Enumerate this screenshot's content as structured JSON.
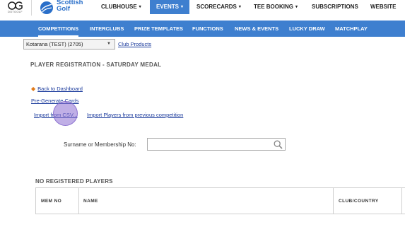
{
  "header": {
    "og_logo_text": "DOTGOLF",
    "brand": {
      "line1": "Scottish",
      "line2": "Golf"
    },
    "nav": [
      {
        "label": "CLUBHOUSE",
        "caret": "▾"
      },
      {
        "label": "EVENTS",
        "caret": "▾",
        "active": true
      },
      {
        "label": "SCORECARDS",
        "caret": "▾"
      },
      {
        "label": "TEE BOOKING",
        "caret": "▾"
      },
      {
        "label": "SUBSCRIPTIONS",
        "caret": ""
      },
      {
        "label": "WEBSITE",
        "caret": ""
      }
    ]
  },
  "subnav": {
    "items": [
      "COMPETITIONS",
      "INTERCLUBS",
      "PRIZE TEMPLATES",
      "FUNCTIONS",
      "NEWS & EVENTS",
      "LUCKY DRAW",
      "MATCHPLAY"
    ]
  },
  "club": {
    "selected": "Kotarana (TEST) (2705)",
    "products_link": "Club Products"
  },
  "page": {
    "title": "PLAYER REGISTRATION - SATURDAY MEDAL",
    "back_link": "Back to Dashboard",
    "pregen_link": "Pre-Generate Cards",
    "import_csv_link": "Import from CSV...",
    "import_prev_link": "Import Players from previous competition"
  },
  "search": {
    "label": "Surname or Membership No:",
    "value": "",
    "placeholder": ""
  },
  "players": {
    "heading": "NO REGISTERED PLAYERS",
    "columns": [
      "MEM NO",
      "NAME",
      "CLUB/COUNTRY"
    ]
  },
  "colors": {
    "nav_blue": "#3e7fcf",
    "link": "#1a3a9c",
    "back_arrow": "#e07a1a",
    "cursor": "#8c6ed2"
  },
  "icons": {
    "back": "arrow-left-icon",
    "search": "search-icon",
    "select": "chevron-down-icon"
  }
}
